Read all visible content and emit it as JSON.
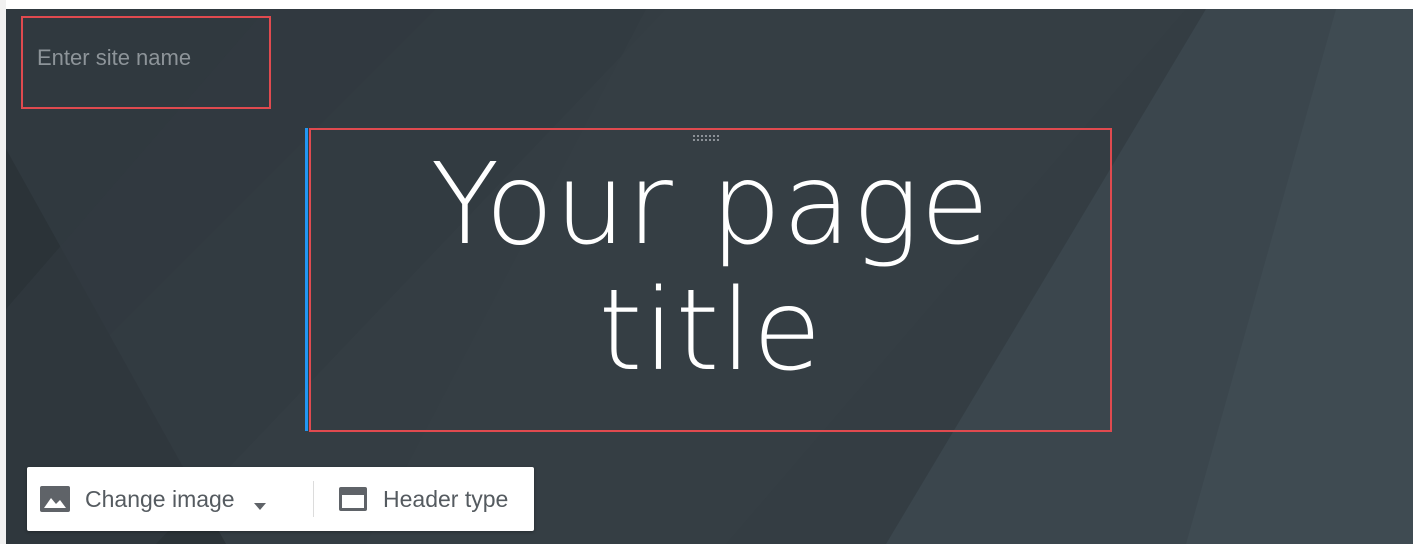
{
  "site_name": {
    "placeholder": "Enter site name",
    "value": ""
  },
  "page_title": {
    "line1": "Your page",
    "line2": "title"
  },
  "toolbar": {
    "change_image_label": "Change image",
    "header_type_label": "Header type"
  },
  "colors": {
    "header_background": "#343d43",
    "highlight_border": "#e04a4f",
    "focus_accent": "#2196f3",
    "title_text": "#ffffff"
  },
  "icons": [
    "image-icon",
    "dropdown-caret-icon",
    "header-type-icon",
    "drag-handle-icon"
  ]
}
